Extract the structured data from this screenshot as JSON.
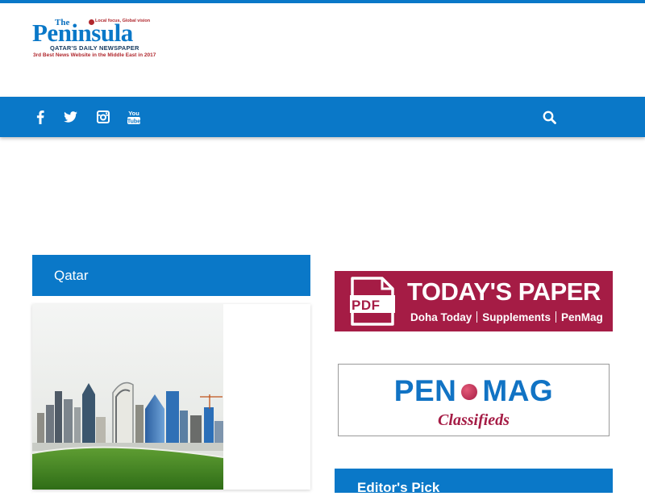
{
  "header": {
    "logo": {
      "the": "The",
      "name": "Peninsula",
      "tagline": "Local focus, Global vision",
      "subtitle": "QATAR'S DAILY NEWSPAPER",
      "award": "3rd Best News Website in the Middle East in 2017"
    }
  },
  "navbar": {
    "background": "#0a78c8",
    "social": [
      {
        "icon": "facebook-icon"
      },
      {
        "icon": "twitter-icon"
      },
      {
        "icon": "instagram-icon"
      },
      {
        "icon": "youtube-icon",
        "text": "You Tube"
      }
    ],
    "search_icon": "search-icon"
  },
  "section": {
    "title": "Qatar"
  },
  "promos": {
    "todays_paper": {
      "badge": "PDF",
      "title": "TODAY'S PAPER",
      "links": [
        "Doha Today",
        "Supplements",
        "PenMag"
      ],
      "color": "#a51c45"
    },
    "penmag": {
      "pen": "PEN",
      "mag": "MAG",
      "classifieds": "Classifieds"
    }
  },
  "sidebar": {
    "partial_heading": "Editor's Pick"
  }
}
